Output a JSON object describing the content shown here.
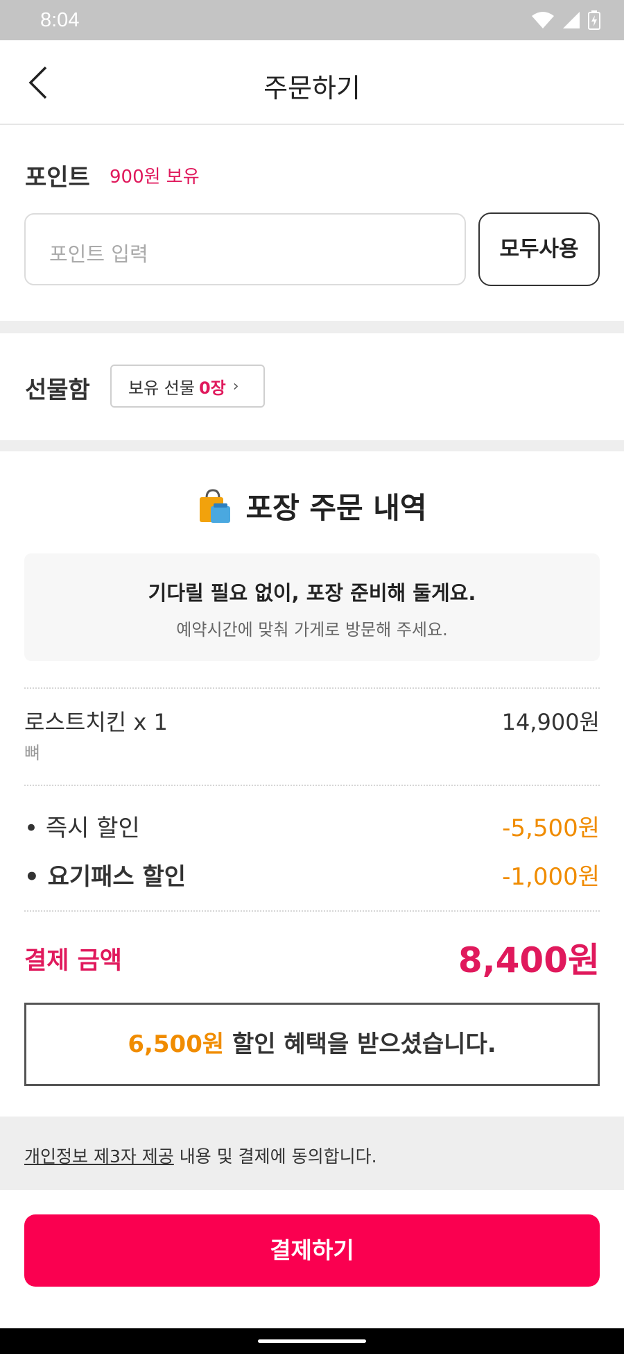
{
  "status_bar": {
    "time": "8:04"
  },
  "header": {
    "title": "주문하기"
  },
  "points": {
    "label": "포인트",
    "owned": "900원 보유",
    "placeholder": "포인트 입력",
    "use_all_label": "모두사용"
  },
  "gift": {
    "label": "선물함",
    "owned_prefix": "보유 선물",
    "owned_count": "0장",
    "chevron": "›"
  },
  "order": {
    "title": "포장 주문 내역",
    "info_line1": "기다릴 필요 없이, 포장 준비해 둘게요.",
    "info_line2": "예약시간에 맞춰 가게로 방문해 주세요.",
    "item": {
      "name": "로스트치킨 x 1",
      "option": "뼈",
      "price": "14,900원"
    },
    "discounts": [
      {
        "label": "• 즉시 할인",
        "value": "-5,500원"
      },
      {
        "label": "• 요기패스 할인",
        "value": "-1,000원"
      }
    ],
    "payment_label": "결제 금액",
    "payment_value": "8,400원",
    "benefit_amount": "6,500원",
    "benefit_text": " 할인 혜택을 받으셨습니다."
  },
  "agreement": {
    "link_text": "개인정보 제3자 제공",
    "rest_text": " 내용 및 결제에 동의합니다."
  },
  "pay_button": {
    "label": "결제하기"
  },
  "colors": {
    "accent": "#fa0050",
    "pink_text": "#e0195c",
    "discount": "#f08c00"
  }
}
